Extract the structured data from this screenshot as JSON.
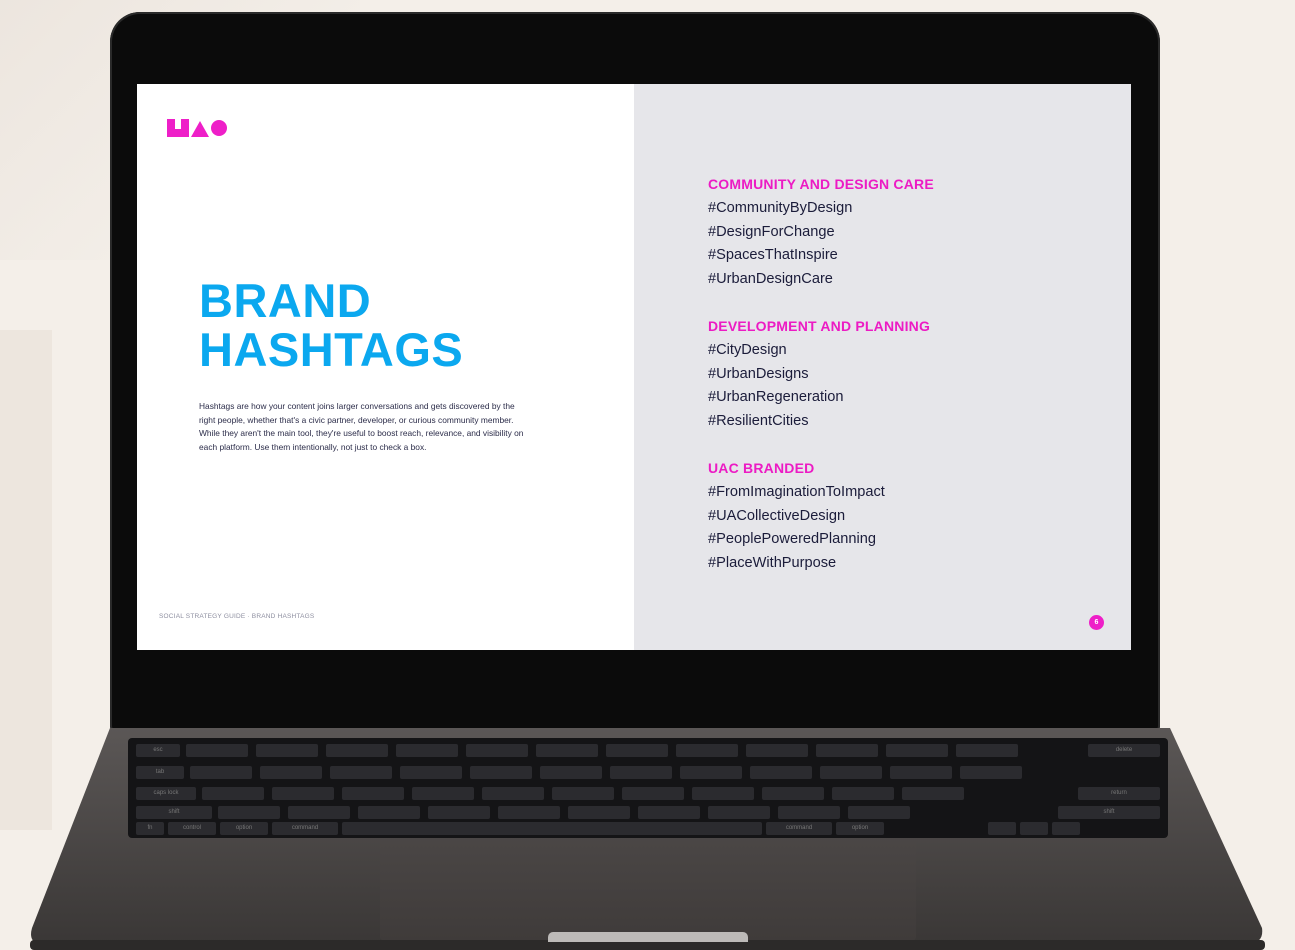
{
  "document": {
    "logo_text": "UAC",
    "title_line1": "BRAND",
    "title_line2": "HASHTAGS",
    "intro": "Hashtags are how your content joins larger conversations and gets discovered by the right people, whether that's a civic partner, developer, or curious community member. While they aren't the main tool, they're useful to boost reach, relevance, and visibility on each platform. Use them intentionally, not just to check a box.",
    "footer": "SOCIAL STRATEGY GUIDE · BRAND HASHTAGS",
    "page_number": "6",
    "groups": [
      {
        "heading": "COMMUNITY AND DESIGN CARE",
        "tags": [
          "#CommunityByDesign",
          "#DesignForChange",
          "#SpacesThatInspire",
          "#UrbanDesignCare"
        ]
      },
      {
        "heading": "DEVELOPMENT AND PLANNING",
        "tags": [
          "#CityDesign",
          "#UrbanDesigns",
          "#UrbanRegeneration",
          "#ResilientCities"
        ]
      },
      {
        "heading": "UAC BRANDED",
        "tags": [
          "#FromImaginationToImpact",
          "#UACollectiveDesign",
          "#PeoplePoweredPlanning",
          "#PlaceWithPurpose"
        ]
      }
    ]
  },
  "keyboard": {
    "key_labels": [
      "esc",
      "tab",
      "caps lock",
      "shift",
      "fn",
      "control",
      "option",
      "command",
      "command",
      "option",
      "delete",
      "return",
      "shift"
    ]
  },
  "colors": {
    "title": "#0ba8ef",
    "accent_magenta": "#ee1fc8",
    "right_panel": "#e6e6ea",
    "background": "#f4efe9"
  }
}
